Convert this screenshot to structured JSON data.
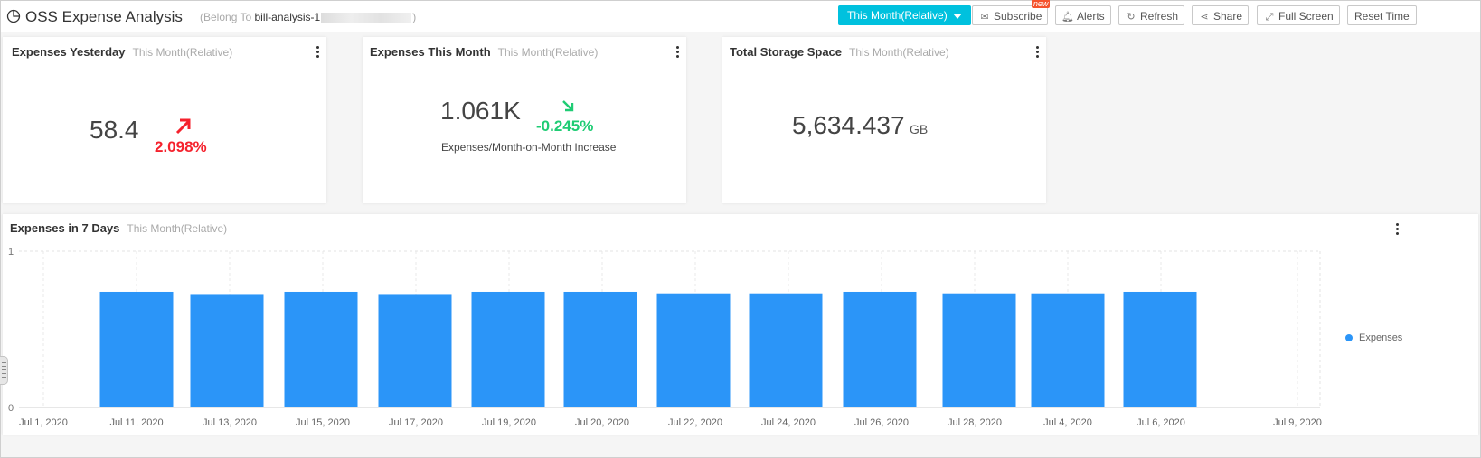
{
  "header": {
    "title": "OSS Expense Analysis",
    "belong_prefix": "(Belong To ",
    "project": "bill-analysis-1",
    "belong_suffix": ")",
    "time_dropdown": "This Month(Relative)",
    "buttons": {
      "subscribe": "Subscribe",
      "new_badge": "new",
      "alerts": "Alerts",
      "refresh": "Refresh",
      "share": "Share",
      "full_screen": "Full Screen",
      "reset_time": "Reset Time"
    }
  },
  "cards": {
    "yesterday": {
      "title": "Expenses Yesterday",
      "range": "This Month(Relative)",
      "value": "58.4",
      "change": "2.098%"
    },
    "month": {
      "title": "Expenses This Month",
      "range": "This Month(Relative)",
      "value": "1.061K",
      "change": "-0.245%",
      "label": "Expenses/Month-on-Month Increase"
    },
    "storage": {
      "title": "Total Storage Space",
      "range": "This Month(Relative)",
      "value": "5,634.437",
      "unit": "GB"
    }
  },
  "chart_panel": {
    "title": "Expenses in 7 Days",
    "range": "This Month(Relative)"
  },
  "colors": {
    "accent": "#00c1de",
    "bar": "#2b95f8",
    "up": "#f5222d",
    "down": "#1fcc74"
  },
  "chart_data": {
    "type": "bar",
    "ylim": [
      0,
      1
    ],
    "y_ticks": [
      "0",
      "1"
    ],
    "x_ticks": [
      "Jul 1, 2020",
      "Jul 11, 2020",
      "Jul 13, 2020",
      "Jul 15, 2020",
      "Jul 17, 2020",
      "Jul 19, 2020",
      "Jul 20, 2020",
      "Jul 22, 2020",
      "Jul 24, 2020",
      "Jul 26, 2020",
      "Jul 28, 2020",
      "Jul 4, 2020",
      "Jul 6, 2020",
      "Jul 9, 2020"
    ],
    "categories": [
      "Jul 11, 2020",
      "Jul 13, 2020",
      "Jul 15, 2020",
      "Jul 17, 2020",
      "Jul 19, 2020",
      "Jul 20, 2020",
      "Jul 22, 2020",
      "Jul 24, 2020",
      "Jul 26, 2020",
      "Jul 28, 2020",
      "Jul 4, 2020",
      "Jul 6, 2020"
    ],
    "series": [
      {
        "name": "Expenses",
        "values": [
          0.74,
          0.72,
          0.74,
          0.72,
          0.74,
          0.74,
          0.73,
          0.73,
          0.74,
          0.73,
          0.73,
          0.74
        ]
      }
    ],
    "grid": true,
    "legend_position": "right"
  }
}
